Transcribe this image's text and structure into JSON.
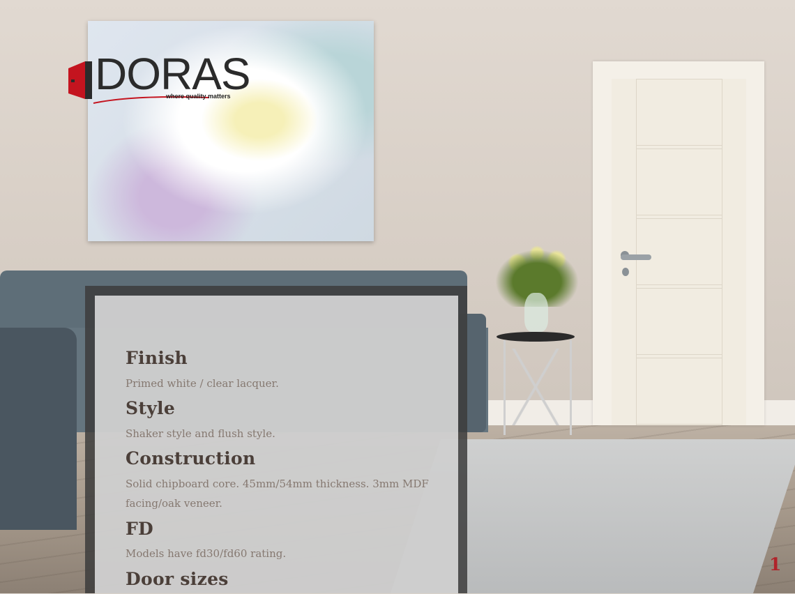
{
  "brand": {
    "name": "DORAS",
    "tagline": "where quality matters",
    "accent_color": "#c4141f"
  },
  "specs": [
    {
      "title": "Finish",
      "text": "Primed white / clear lacquer."
    },
    {
      "title": "Style",
      "text": "Shaker style and flush style."
    },
    {
      "title": "Construction",
      "text": "Solid chipboard core. 45mm/54mm thickness. 3mm MDF facing/oak veneer."
    },
    {
      "title": "FD",
      "text": "Models have fd30/fd60 rating."
    },
    {
      "title": "Door sizes",
      "text": ""
    }
  ],
  "page_number": "1"
}
